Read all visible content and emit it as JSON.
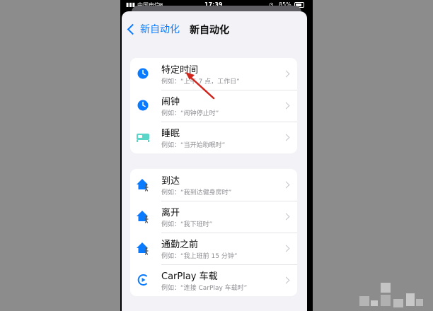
{
  "status_bar": {
    "signal": "▮▮▮",
    "carrier": "中国电信",
    "wifi": "≋",
    "time": "17:39",
    "lock": "⊙",
    "battery_text": "85%",
    "battery_level": 0.85
  },
  "nav": {
    "back_label": "新自动化",
    "title": "新自动化"
  },
  "sections": [
    {
      "items": [
        {
          "icon": "clock-icon",
          "title": "特定时间",
          "subtitle": "例如：“上午 7 点，工作日”"
        },
        {
          "icon": "alarm-icon",
          "title": "闹钟",
          "subtitle": "例如：“闹钟停止时”"
        },
        {
          "icon": "bed-icon",
          "title": "睡眠",
          "subtitle": "例如：“当开始助眠时”"
        }
      ]
    },
    {
      "items": [
        {
          "icon": "home-arrive-icon",
          "title": "到达",
          "subtitle": "例如：“我到达健身房时”"
        },
        {
          "icon": "home-leave-icon",
          "title": "离开",
          "subtitle": "例如：“我下班时”"
        },
        {
          "icon": "commute-icon",
          "title": "通勤之前",
          "subtitle": "例如：“我上班前 15 分钟”"
        },
        {
          "icon": "carplay-icon",
          "title": "CarPlay 车载",
          "subtitle": "例如：“连接 CarPlay 车载时”"
        }
      ]
    }
  ],
  "colors": {
    "accent": "#0a7aff",
    "background": "#f2f2f7",
    "annotation_arrow": "#d0261e",
    "bed_icon": "#5ad6c8"
  }
}
